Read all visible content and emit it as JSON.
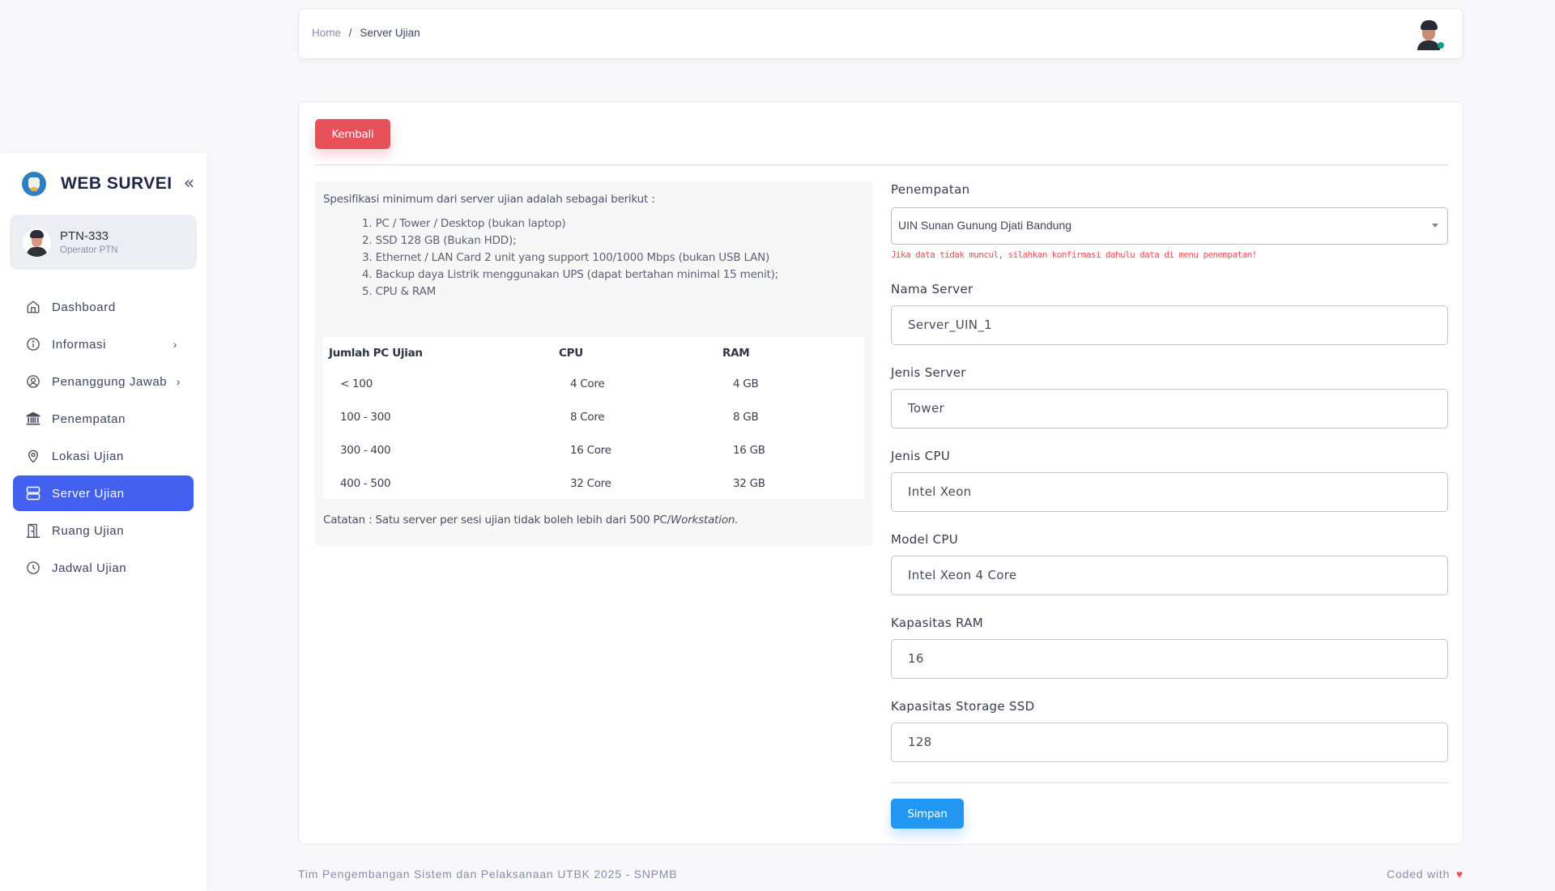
{
  "sidebar": {
    "brand_title": "WEB SURVEI",
    "collapse_icon": "«",
    "user": {
      "name": "PTN-333",
      "role": "Operator PTN"
    },
    "items": [
      {
        "label": "Dashboard",
        "icon": "home-icon",
        "has_submenu": false,
        "active": false
      },
      {
        "label": "Informasi",
        "icon": "info-icon",
        "has_submenu": true,
        "active": false
      },
      {
        "label": "Penanggung Jawab",
        "icon": "user-circle-icon",
        "has_submenu": true,
        "active": false
      },
      {
        "label": "Penempatan",
        "icon": "bank-icon",
        "has_submenu": false,
        "active": false
      },
      {
        "label": "Lokasi Ujian",
        "icon": "map-pin-icon",
        "has_submenu": false,
        "active": false
      },
      {
        "label": "Server Ujian",
        "icon": "server-icon",
        "has_submenu": false,
        "active": true
      },
      {
        "label": "Ruang Ujian",
        "icon": "door-icon",
        "has_submenu": false,
        "active": false
      },
      {
        "label": "Jadwal Ujian",
        "icon": "clock-icon",
        "has_submenu": false,
        "active": false
      }
    ],
    "chevron": "›"
  },
  "topbar": {
    "breadcrumb": {
      "home": "Home",
      "separator": "/",
      "current": "Server Ujian"
    },
    "status_color": "#05a187"
  },
  "main": {
    "back_button": "Kembali",
    "info": {
      "intro": "Spesifikasi minimum dari server ujian adalah sebagai berikut :",
      "requirements": [
        "1. PC / Tower / Desktop (bukan laptop)",
        "2. SSD 128 GB (Bukan HDD);",
        "3. Ethernet / LAN Card 2 unit yang support 100/1000 Mbps (bukan USB LAN)",
        "4. Backup daya Listrik menggunakan UPS (dapat bertahan minimal 15 menit);",
        "5. CPU & RAM"
      ],
      "table": {
        "headers": [
          "Jumlah PC Ujian",
          "CPU",
          "RAM"
        ],
        "rows": [
          [
            "< 100",
            "4 Core",
            "4 GB"
          ],
          [
            "100 - 300",
            "8 Core",
            "8 GB"
          ],
          [
            "300 - 400",
            "16 Core",
            "16 GB"
          ],
          [
            "400 - 500",
            "32 Core",
            "32 GB"
          ]
        ]
      },
      "note_prefix": "Catatan : Satu server per sesi ujian tidak boleh lebih dari 500 PC/",
      "note_italic": "Workstation."
    },
    "form": {
      "penempatan": {
        "label": "Penempatan",
        "value": "UIN Sunan Gunung Djati Bandung",
        "help": "Jika data tidak muncul, silahkan konfirmasi dahulu data di menu penempatan!"
      },
      "fields": [
        {
          "label": "Nama Server",
          "value": "Server_UIN_1"
        },
        {
          "label": "Jenis Server",
          "value": "Tower"
        },
        {
          "label": "Jenis CPU",
          "value": "Intel Xeon"
        },
        {
          "label": "Model CPU",
          "value": "Intel Xeon 4 Core"
        },
        {
          "label": "Kapasitas RAM",
          "value": "16"
        },
        {
          "label": "Kapasitas Storage SSD",
          "value": "128"
        }
      ],
      "save_button": "Simpan"
    }
  },
  "footer": {
    "left": "Tim Pengembangan Sistem dan Pelaksanaan UTBK 2025 - SNPMB",
    "right": "Coded with",
    "heart": "♥"
  },
  "colors": {
    "primary": "#4361ee",
    "danger": "#e7515a",
    "info": "#2196f3"
  }
}
